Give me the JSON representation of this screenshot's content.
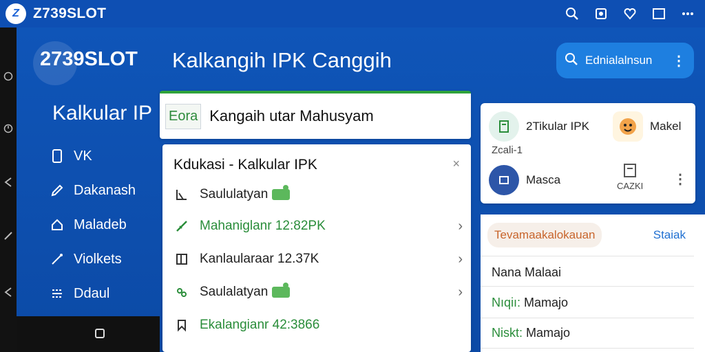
{
  "topbar": {
    "logo_letter": "Z",
    "brand": "Z739SLOT",
    "actions": [
      "search-icon",
      "screenshot-icon",
      "heart-icon",
      "window-icon",
      "more-icon"
    ]
  },
  "header": {
    "brand": "2739SLOT",
    "title": "Kalkangih  IPK Canggih",
    "search_label": "Ednialalnsun",
    "more": "⋮"
  },
  "sidebar": {
    "title": "Kalkular IP",
    "items": [
      {
        "label": "VK",
        "icon": "phone-icon"
      },
      {
        "label": "Dakanash",
        "icon": "pencil-icon"
      },
      {
        "label": "Maladeb",
        "icon": "home-icon"
      },
      {
        "label": "Violkets",
        "icon": "wand-icon"
      },
      {
        "label": "Ddaul",
        "icon": "list-icon"
      }
    ]
  },
  "center": {
    "top_tag": "Eora",
    "top_text": "Kangaih utar Mahusyam",
    "title": "Kdukasi - Kalkular IPK",
    "close": "×",
    "rows": [
      {
        "label": "Saululatyan",
        "badge": true,
        "chevron": false,
        "green": false,
        "icon": "chart-icon"
      },
      {
        "label": "Mahaniglanr  12:82PK",
        "badge": false,
        "chevron": true,
        "green": true,
        "icon": "slash-icon"
      },
      {
        "label": "Kanlaularaar  12.37K",
        "badge": false,
        "chevron": true,
        "green": false,
        "icon": "columns-icon"
      },
      {
        "label": "Saulalatyan",
        "badge": true,
        "chevron": true,
        "green": false,
        "icon": "group-icon"
      },
      {
        "label": "Ekalangianr  42:3866",
        "badge": false,
        "chevron": false,
        "green": true,
        "icon": "bookmark-icon"
      }
    ]
  },
  "right_top": {
    "item1": "2Tikular IPK",
    "item1_sub": "Zcali-1",
    "item2": "Makel",
    "item3": "Masca",
    "item4": "CAZKI",
    "more": "⋮"
  },
  "right_bottom": {
    "pill": "Tevamaakalokauan",
    "link": "Staiak",
    "row1": "Nana Malaai",
    "row2_k": "Nıqiı:",
    "row2_v": " Mamajo",
    "row3_k": "Niskt:",
    "row3_v": " Mamajo"
  },
  "colors": {
    "primary": "#0f55b8",
    "topbar": "#0e4fb3",
    "accent_green": "#2a8d3a",
    "accent_orange": "#c8652c",
    "link": "#1f6fd1"
  }
}
